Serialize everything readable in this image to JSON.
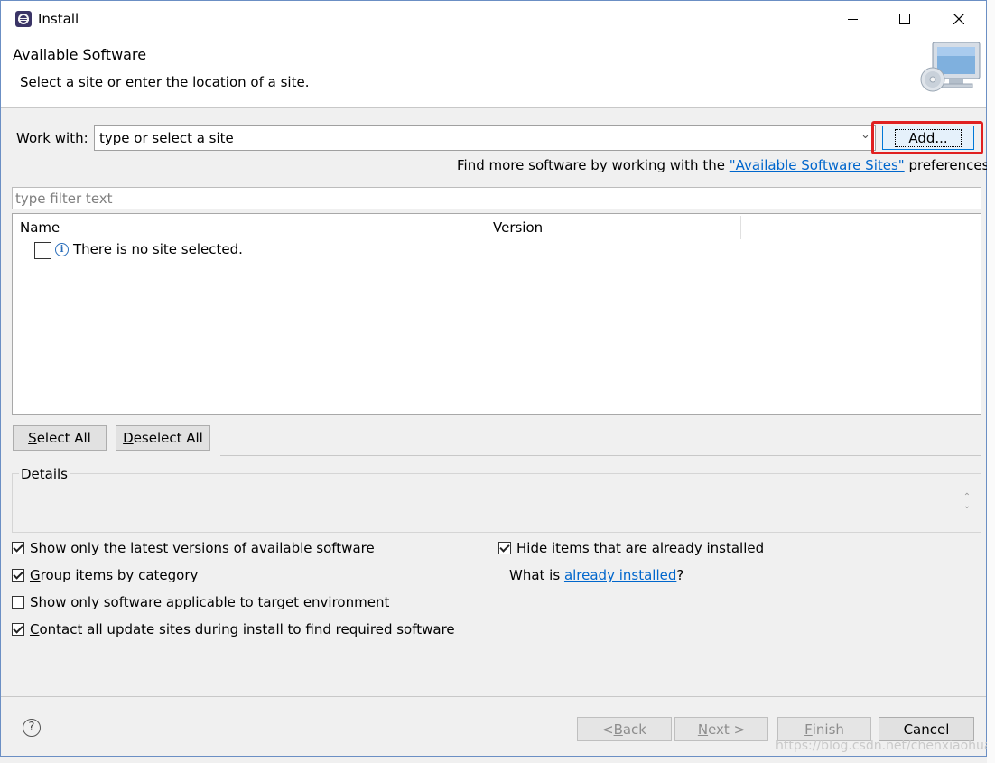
{
  "window": {
    "title": "Install",
    "minimize_icon": "minimize-icon",
    "maximize_icon": "maximize-icon",
    "close_icon": "close-icon"
  },
  "header": {
    "title": "Available Software",
    "subtitle": "Select a site or enter the location of a site."
  },
  "work_with": {
    "label_prefix": "W",
    "label_rest": "ork with:",
    "combo_value": "type or select a site",
    "add_button_prefix": "A",
    "add_button_rest": "dd..."
  },
  "find_more": {
    "before": "Find more software by working with the ",
    "link": "\"Available Software Sites\"",
    "after": " preferences."
  },
  "filter": {
    "placeholder": "type filter text"
  },
  "table": {
    "columns": [
      "Name",
      "Version"
    ],
    "rows": [
      {
        "checked": false,
        "icon": "info-icon",
        "text": "There is no site selected."
      }
    ]
  },
  "selection_buttons": {
    "select_all_prefix": "S",
    "select_all_rest": "elect All",
    "deselect_all_prefix": "D",
    "deselect_all_rest": "eselect All"
  },
  "details": {
    "label": "Details"
  },
  "options_left": [
    {
      "checked": true,
      "before": "Show only the ",
      "mnemonic": "l",
      "after": "atest versions of available software"
    },
    {
      "checked": true,
      "before": "",
      "mnemonic": "G",
      "after": "roup items by category"
    },
    {
      "checked": false,
      "before": "Show only software applicable to target environment",
      "mnemonic": "",
      "after": ""
    },
    {
      "checked": true,
      "before": "",
      "mnemonic": "C",
      "after": "ontact all update sites during install to find required software"
    }
  ],
  "options_right": {
    "hide_installed": {
      "checked": true,
      "mnemonic": "H",
      "rest": "ide items that are already installed"
    },
    "what_is": {
      "before": "What is ",
      "link": "already installed",
      "after": "?"
    }
  },
  "footer": {
    "help_icon": "help-icon",
    "back_prefix": "< ",
    "back_mnemonic": "B",
    "back_rest": "ack",
    "next_mnemonic": "N",
    "next_rest": "ext >",
    "finish_mnemonic": "F",
    "finish_rest": "inish",
    "cancel": "Cancel"
  },
  "watermark": "https://blog.csdn.net/chenxiaohua",
  "colors": {
    "highlight_box": "#e02020",
    "link": "#0066cc",
    "window_border": "#6b8fc4"
  }
}
